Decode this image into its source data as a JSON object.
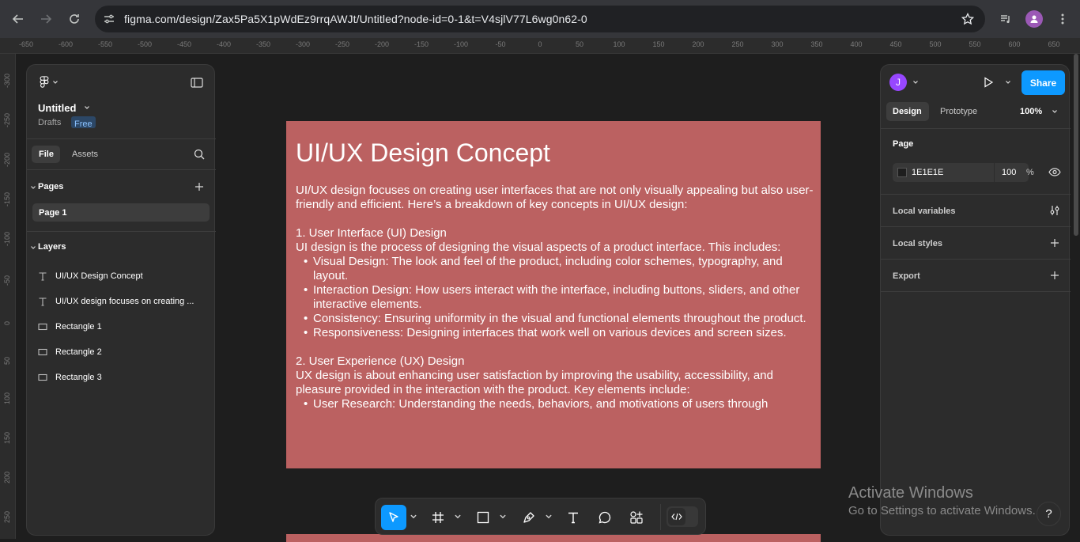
{
  "browser": {
    "url": "figma.com/design/Zax5Pa5X1pWdEz9rrqAWJt/Untitled?node-id=0-1&t=V4sjlV77L6wg0n62-0"
  },
  "ruler": {
    "top_labels": [
      "-650",
      "-600",
      "-550",
      "-500",
      "-450",
      "-400",
      "-350",
      "-300",
      "-250",
      "-200",
      "-150",
      "-100",
      "-50",
      "0",
      "50",
      "100",
      "150",
      "200",
      "250",
      "300",
      "350",
      "400",
      "450",
      "500",
      "550",
      "600",
      "650"
    ],
    "left_labels": [
      "-300",
      "-250",
      "-200",
      "-150",
      "-100",
      "-50",
      "0",
      "50",
      "100",
      "150",
      "200",
      "250"
    ]
  },
  "left_panel": {
    "file_title": "Untitled",
    "drafts_label": "Drafts",
    "plan_badge": "Free",
    "tabs": [
      "File",
      "Assets"
    ],
    "pages_header": "Pages",
    "pages": [
      "Page 1"
    ],
    "layers_header": "Layers",
    "layers": [
      {
        "name": "UI/UX Design Concept",
        "icon": "text-icon"
      },
      {
        "name": "UI/UX design focuses on creating ...",
        "icon": "text-icon"
      },
      {
        "name": "Rectangle 1",
        "icon": "rectangle-icon"
      },
      {
        "name": "Rectangle 2",
        "icon": "rectangle-icon"
      },
      {
        "name": "Rectangle 3",
        "icon": "rectangle-icon"
      }
    ]
  },
  "right_panel": {
    "avatar_letter": "J",
    "share_label": "Share",
    "tabs": [
      "Design",
      "Prototype"
    ],
    "zoom": "100%",
    "page_section": "Page",
    "page_color": "1E1E1E",
    "page_opacity": "100",
    "percent_sign": "%",
    "sections": [
      "Local variables",
      "Local styles",
      "Export"
    ]
  },
  "frame": {
    "title": "UI/UX Design Concept",
    "intro": "UI/UX design focuses on creating user interfaces that are not only visually appealing but also user-friendly and efficient. Here’s a breakdown of key concepts in UI/UX design:",
    "section1_heading": "1. User Interface (UI) Design",
    "section1_text": "UI design is the process of designing the visual aspects of a product interface. This includes:",
    "section1_bullets": [
      "Visual Design: The look and feel of the product, including color schemes, typography, and layout.",
      "Interaction Design: How users interact with the interface, including buttons, sliders, and other interactive elements.",
      "Consistency: Ensuring uniformity in the visual and functional elements throughout the product.",
      "Responsiveness: Designing interfaces that work well on various devices and screen sizes."
    ],
    "section2_heading": "2. User Experience (UX) Design",
    "section2_text": "UX design is about enhancing user satisfaction by improving the usability, accessibility, and pleasure provided in the interaction with the product. Key elements include:",
    "section2_bullets": [
      "User Research: Understanding the needs, behaviors, and motivations of users through"
    ]
  },
  "watermark": {
    "line1": "Activate Windows",
    "line2": "Go to Settings to activate Windows."
  },
  "help_label": "?",
  "colors": {
    "frame_fill": "#bb6161",
    "share_button": "#0d99ff",
    "select_tool": "#0d99ff",
    "avatar": "#9747ff",
    "free_badge": "#2c4766"
  }
}
